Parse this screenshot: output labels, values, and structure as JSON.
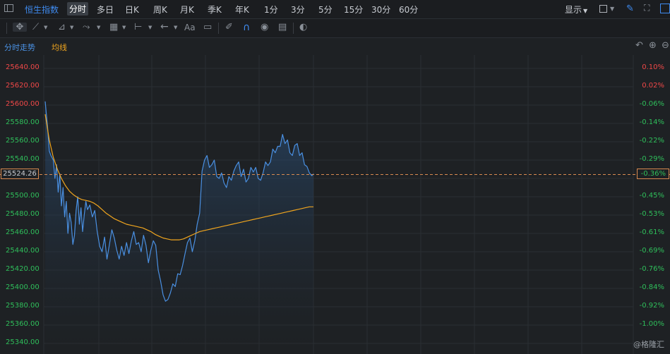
{
  "toolbar": {
    "title": "恒生指数",
    "periods": [
      "分时",
      "多日",
      "日K",
      "周K",
      "月K",
      "季K",
      "年K",
      "1分",
      "3分",
      "5分",
      "15分",
      "30分",
      "60分"
    ],
    "active_period": "分时",
    "display_label": "显示"
  },
  "drawing_tools": {
    "text_tool_label": "Aa"
  },
  "legend": {
    "price_label": "分时走势",
    "avg_label": "均线"
  },
  "current_price_label": "25524.26",
  "current_pct_label": "-0.36%",
  "watermark": "@格隆汇",
  "colors": {
    "background": "#1e2124",
    "price_line": "#4a90e2",
    "avg_line": "#f0a51e",
    "up": "#f04848",
    "down": "#2fbf5b",
    "ref_line": "#d98a50"
  },
  "chart_data": {
    "type": "line",
    "title": "",
    "xlabel": "",
    "ylabel": "",
    "ylim": [
      25330,
      25650
    ],
    "ref_price": 25524.26,
    "y_ticks": [
      "25640.00",
      "25620.00",
      "25600.00",
      "25580.00",
      "25560.00",
      "25540.00",
      "25524.26",
      "25500.00",
      "25480.00",
      "25460.00",
      "25440.00",
      "25420.00",
      "25400.00",
      "25380.00",
      "25360.00",
      "25340.00"
    ],
    "pct_ticks": [
      "0.10%",
      "0.02%",
      "-0.06%",
      "-0.14%",
      "-0.22%",
      "-0.29%",
      "-0.36%",
      "-0.45%",
      "-0.53%",
      "-0.61%",
      "-0.69%",
      "-0.76%",
      "-0.84%",
      "-0.92%",
      "-1.00%"
    ],
    "grid": true,
    "legend": "top-left",
    "x_total": 330,
    "series": [
      {
        "name": "分时走势",
        "x": [
          0,
          3,
          5,
          7,
          10,
          12,
          14,
          16,
          18,
          20,
          22,
          24,
          26,
          28,
          30,
          32,
          34,
          36,
          38,
          40,
          42,
          44,
          46,
          48,
          50,
          52,
          55,
          58,
          61,
          64,
          67,
          70,
          73,
          76,
          79,
          82,
          85,
          88,
          91,
          94,
          97,
          100,
          103,
          106,
          109,
          112,
          115,
          118,
          121,
          124,
          127,
          130,
          133,
          136,
          139,
          142,
          145,
          148,
          151,
          154,
          157,
          160,
          163,
          166,
          169,
          172,
          175,
          178,
          181,
          184,
          187,
          190,
          193,
          196,
          199,
          202,
          205,
          208,
          211,
          214,
          217,
          220,
          223,
          226,
          229,
          232,
          235,
          238,
          241,
          244,
          247,
          250,
          253,
          256,
          259,
          262,
          265,
          268,
          271,
          274,
          277,
          280,
          283,
          286,
          289,
          292,
          295,
          298,
          301,
          304,
          307,
          310,
          313,
          316,
          319,
          322,
          325,
          328,
          330
        ],
        "values": [
          25604,
          25575,
          25550,
          25545,
          25540,
          25520,
          25535,
          25505,
          25525,
          25490,
          25510,
          25478,
          25495,
          25460,
          25482,
          25472,
          25448,
          25458,
          25485,
          25500,
          25470,
          25488,
          25462,
          25480,
          25495,
          25486,
          25491,
          25478,
          25485,
          25462,
          25446,
          25440,
          25456,
          25432,
          25448,
          25464,
          25455,
          25442,
          25432,
          25446,
          25436,
          25450,
          25438,
          25452,
          25462,
          25448,
          25450,
          25440,
          25458,
          25447,
          25428,
          25442,
          25452,
          25447,
          25420,
          25408,
          25393,
          25386,
          25388,
          25395,
          25405,
          25402,
          25416,
          25415,
          25425,
          25438,
          25450,
          25455,
          25440,
          25452,
          25470,
          25482,
          25528,
          25540,
          25545,
          25532,
          25535,
          25540,
          25522,
          25520,
          25526,
          25515,
          25510,
          25522,
          25518,
          25528,
          25534,
          25538,
          25522,
          25530,
          25516,
          25520,
          25532,
          25527,
          25532,
          25520,
          25518,
          25526,
          25538,
          25534,
          25538,
          25552,
          25548,
          25555,
          25555,
          25568,
          25558,
          25562,
          25548,
          25545,
          25556,
          25558,
          25545,
          25548,
          25535,
          25533,
          25526,
          25523,
          25525
        ]
      },
      {
        "name": "均线",
        "x": [
          0,
          5,
          10,
          15,
          20,
          25,
          30,
          35,
          40,
          45,
          50,
          55,
          60,
          65,
          70,
          75,
          80,
          85,
          90,
          95,
          100,
          105,
          110,
          115,
          120,
          125,
          130,
          135,
          140,
          145,
          150,
          155,
          160,
          165,
          170,
          175,
          180,
          185,
          190,
          195,
          200,
          205,
          210,
          215,
          220,
          225,
          230,
          235,
          240,
          245,
          250,
          255,
          260,
          265,
          270,
          275,
          280,
          285,
          290,
          295,
          300,
          305,
          310,
          315,
          320,
          325,
          330
        ],
        "values": [
          25590,
          25562,
          25543,
          25530,
          25520,
          25512,
          25506,
          25502,
          25499,
          25497,
          25496,
          25495,
          25493,
          25490,
          25486,
          25482,
          25479,
          25476,
          25474,
          25472,
          25470,
          25469,
          25468,
          25467,
          25466,
          25464,
          25462,
          25459,
          25457,
          25455,
          25454,
          25453,
          25453,
          25453,
          25454,
          25456,
          25458,
          25460,
          25462,
          25463,
          25464,
          25465,
          25466,
          25467,
          25468,
          25469,
          25470,
          25471,
          25472,
          25473,
          25474,
          25475,
          25476,
          25477,
          25478,
          25479,
          25480,
          25481,
          25482,
          25483,
          25484,
          25485,
          25486,
          25487,
          25488,
          25489,
          25489
        ]
      }
    ]
  }
}
